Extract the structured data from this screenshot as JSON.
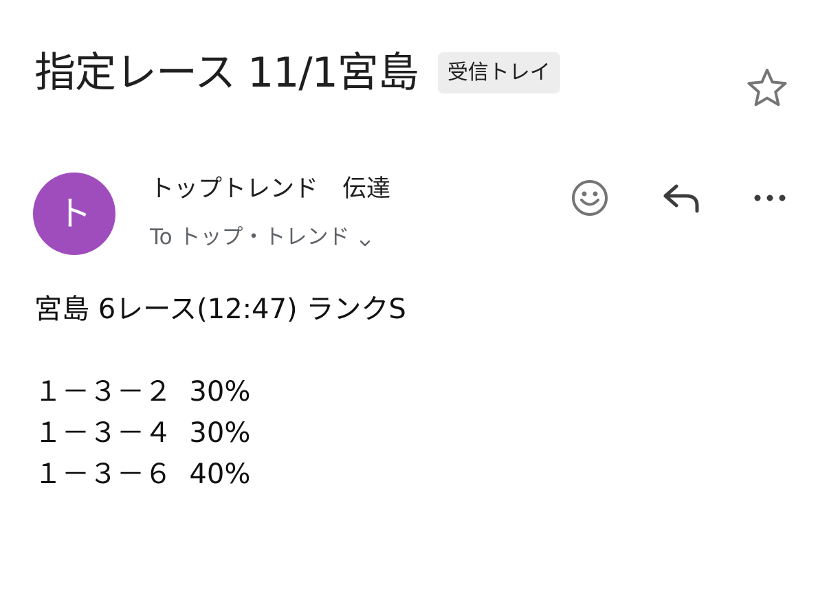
{
  "email": {
    "subject": "指定レース 11/1宮島",
    "label": "受信トレイ",
    "starred": false,
    "sender": {
      "avatar_letter": "ト",
      "avatar_color": "#9f4dbd",
      "name": "トップトレンド　伝達",
      "recipient_line": "To トップ・トレンド"
    },
    "actions": {
      "emoji": "smile-icon",
      "reply": "reply-icon",
      "more": "more-horizontal-icon"
    },
    "body": {
      "heading": "宮島 6レース(12:47) ランクS",
      "lines": [
        "１－３－２  30%",
        "１－３－４  30%",
        "１－３－６  40%"
      ]
    }
  }
}
